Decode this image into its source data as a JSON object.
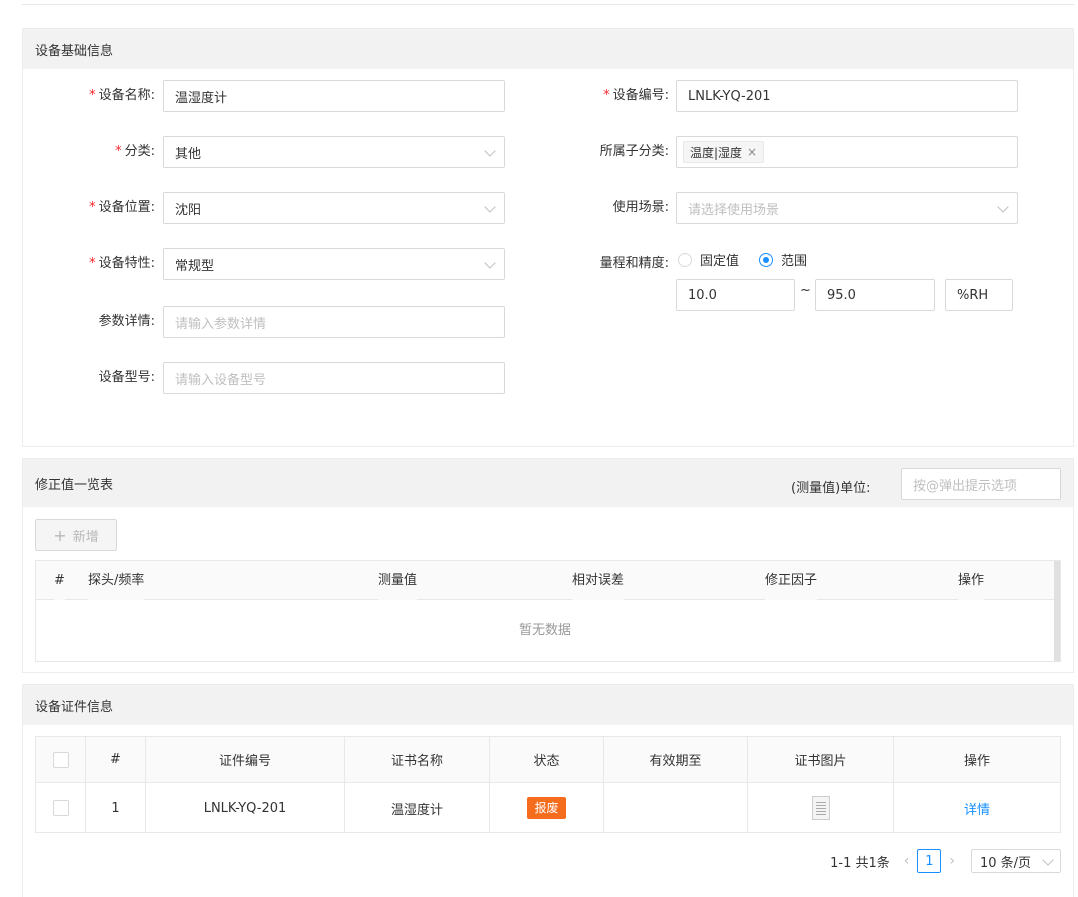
{
  "basic": {
    "title": "设备基础信息",
    "name_label": "设备名称:",
    "name_value": "温湿度计",
    "code_label": "设备编号:",
    "code_value": "LNLK-YQ-201",
    "category_label": "分类:",
    "category_value": "其他",
    "subcategory_label": "所属子分类:",
    "subcategory_tag": "温度|湿度",
    "location_label": "设备位置:",
    "location_value": "沈阳",
    "scene_label": "使用场景:",
    "scene_placeholder": "请选择使用场景",
    "feature_label": "设备特性:",
    "feature_value": "常规型",
    "range_label": "量程和精度:",
    "radio_fixed": "固定值",
    "radio_range": "范围",
    "radio_selected": "范围",
    "range_min": "10.0",
    "range_sep": "~",
    "range_max": "95.0",
    "range_unit": "%RH",
    "param_label": "参数详情:",
    "param_placeholder": "请输入参数详情",
    "model_label": "设备型号:",
    "model_placeholder": "请输入设备型号"
  },
  "correction": {
    "title": "修正值一览表",
    "unit_label": "(测量值)单位:",
    "unit_placeholder": "按@弹出提示选项",
    "add_button": "新增",
    "columns": [
      "#",
      "探头/频率",
      "测量值",
      "相对误差",
      "修正因子",
      "操作"
    ],
    "empty_text": "暂无数据"
  },
  "certificate": {
    "title": "设备证件信息",
    "columns": [
      "#",
      "证件编号",
      "证书名称",
      "状态",
      "有效期至",
      "证书图片",
      "操作"
    ],
    "rows": [
      {
        "index": "1",
        "cert_no": "LNLK-YQ-201",
        "cert_name": "温湿度计",
        "status": "报废",
        "valid_until": "",
        "action": "详情"
      }
    ],
    "pager": {
      "summary": "1-1 共1条",
      "current": "1",
      "page_size": "10 条/页"
    }
  },
  "colors": {
    "primary": "#1890ff",
    "required": "#f5222d",
    "status_scrapped": "#f56c1d"
  }
}
